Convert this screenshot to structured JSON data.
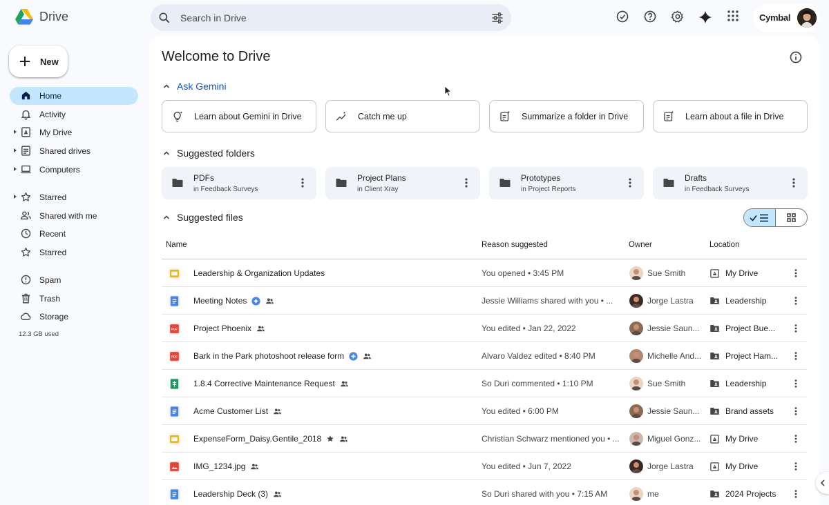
{
  "app": {
    "name": "Drive"
  },
  "search": {
    "placeholder": "Search in Drive"
  },
  "header": {
    "org_name": "Cymbal"
  },
  "sidebar": {
    "new_label": "New",
    "items": [
      {
        "label": "Home",
        "icon": "home-icon",
        "active": true
      },
      {
        "label": "Activity",
        "icon": "bell-icon"
      },
      {
        "label": "My Drive",
        "icon": "my-drive-icon"
      },
      {
        "label": "Shared drives",
        "icon": "shared-drives-icon"
      },
      {
        "label": "Computers",
        "icon": "computer-icon"
      },
      {
        "label": "Starred",
        "icon": "star-icon"
      },
      {
        "label": "Shared with me",
        "icon": "people-icon"
      },
      {
        "label": "Recent",
        "icon": "clock-icon"
      },
      {
        "label": "Starred",
        "icon": "star-icon"
      },
      {
        "label": "Spam",
        "icon": "spam-icon"
      },
      {
        "label": "Trash",
        "icon": "trash-icon"
      },
      {
        "label": "Storage",
        "icon": "cloud-icon"
      }
    ],
    "storage_used": "12.3 GB used"
  },
  "main": {
    "title": "Welcome to Drive",
    "gemini": {
      "section_label": "Ask Gemini",
      "cards": [
        {
          "label": "Learn about Gemini in Drive",
          "icon": "lightbulb-sparkle-icon"
        },
        {
          "label": "Catch me up",
          "icon": "trend-sparkle-icon"
        },
        {
          "label": "Summarize a folder in Drive",
          "icon": "summarize-icon"
        },
        {
          "label": "Learn about a file in Drive",
          "icon": "summarize-icon"
        }
      ]
    },
    "suggested_folders": {
      "section_label": "Suggested folders",
      "folders": [
        {
          "name": "PDFs",
          "location": "in Feedback Surveys"
        },
        {
          "name": "Project Plans",
          "location": "in Client Xray"
        },
        {
          "name": "Prototypes",
          "location": "in Project Reports"
        },
        {
          "name": "Drafts",
          "location": "in Feedback Surveys"
        }
      ]
    },
    "suggested_files": {
      "section_label": "Suggested files",
      "columns": {
        "name": "Name",
        "reason": "Reason suggested",
        "owner": "Owner",
        "location": "Location"
      },
      "rows": [
        {
          "name": "Leadership & Organization Updates",
          "type": "slides",
          "reason": "You opened • 3:45 PM",
          "owner": "Sue Smith",
          "location": "My Drive",
          "loc_type": "my-drive",
          "gemini": false,
          "shared": false,
          "starred": false,
          "owner_color": "#e8d5c8"
        },
        {
          "name": "Meeting Notes",
          "type": "docs",
          "reason": "Jessie Williams shared with you • ...",
          "owner": "Jorge Lastra",
          "location": "Leadership",
          "loc_type": "shared-folder",
          "gemini": true,
          "shared": true,
          "starred": false,
          "owner_color": "#3b2a24"
        },
        {
          "name": "Project Phoenix",
          "type": "pdf",
          "reason": "You edited • Jan 22, 2022",
          "owner": "Jessie Saun...",
          "location": "Project Bue...",
          "loc_type": "shared-folder",
          "gemini": false,
          "shared": true,
          "starred": false,
          "owner_color": "#8a6a52"
        },
        {
          "name": "Bark in the Park photoshoot release form",
          "type": "pdf",
          "reason": "Alvaro Valdez edited • 8:40 PM",
          "owner": "Michelle And...",
          "location": "Project Ham...",
          "loc_type": "shared-folder",
          "gemini": true,
          "shared": true,
          "starred": false,
          "owner_color": "#b08a70"
        },
        {
          "name": "1.8.4 Corrective Maintenance Request",
          "type": "sheets",
          "reason": "So Duri commented • 1:10 PM",
          "owner": "Sue Smith",
          "location": "Leadership",
          "loc_type": "shared-folder",
          "gemini": false,
          "shared": true,
          "starred": false,
          "owner_color": "#e8d5c8"
        },
        {
          "name": "Acme Customer List",
          "type": "docs",
          "reason": "You edited • 6:00 PM",
          "owner": "Jessie Saun...",
          "location": "Brand assets",
          "loc_type": "shared-folder",
          "gemini": false,
          "shared": true,
          "starred": false,
          "owner_color": "#8a6a52"
        },
        {
          "name": "ExpenseForm_Daisy.Gentile_2018",
          "type": "slides",
          "reason": "Christian Schwarz mentioned you • ...",
          "owner": "Miguel Gonz...",
          "location": "My Drive",
          "loc_type": "my-drive",
          "gemini": false,
          "shared": true,
          "starred": true,
          "owner_color": "#c9b8b0"
        },
        {
          "name": "IMG_1234.jpg",
          "type": "image",
          "reason": "You edited • Jun 7, 2022",
          "owner": "Jorge Lastra",
          "location": "My Drive",
          "loc_type": "my-drive",
          "gemini": false,
          "shared": true,
          "starred": false,
          "owner_color": "#3b2a24"
        },
        {
          "name": "Leadership Deck (3)",
          "type": "docs",
          "reason": "So Duri shared with you • 7:15 AM",
          "owner": "me",
          "location": "2024 Projects",
          "loc_type": "shared-folder",
          "gemini": false,
          "shared": true,
          "starred": false,
          "owner_color": "#e8d5c8"
        }
      ]
    }
  },
  "colors": {
    "accent": "#0b57d0",
    "active_nav": "#c2e7ff",
    "background": "#f8fafd",
    "search_bg": "#e9eef6",
    "folder_card": "#f0f4f9"
  }
}
